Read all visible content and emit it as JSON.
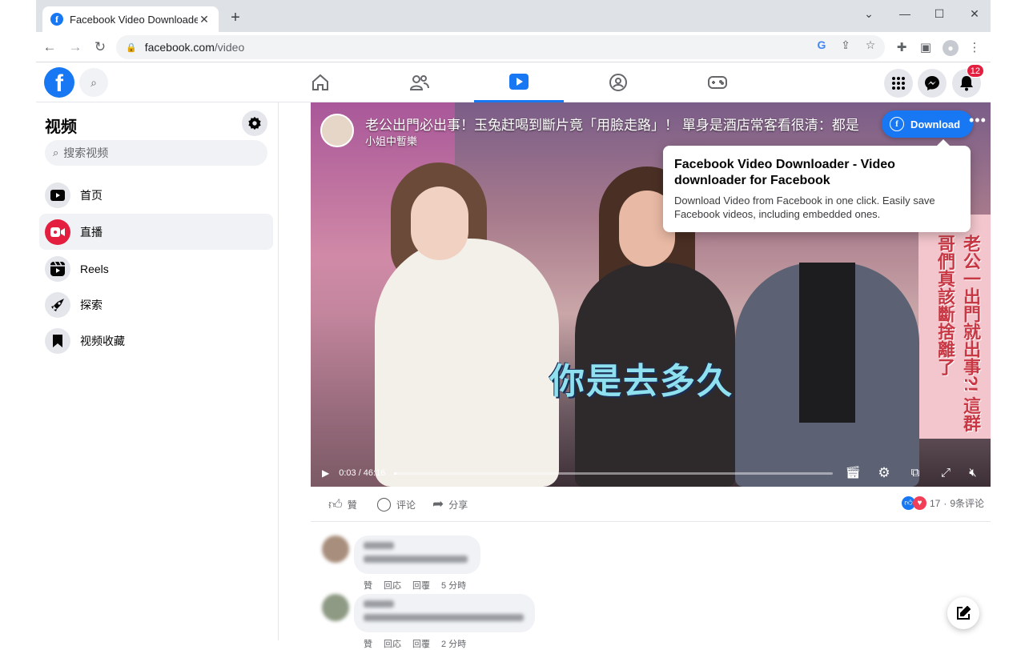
{
  "browser": {
    "tab_title": "Facebook Video Downloader",
    "url_host": "facebook.com",
    "url_path": "/video"
  },
  "fb": {
    "logo": "f",
    "notifications_count": "12"
  },
  "sidebar": {
    "title": "视频",
    "search_placeholder": "搜索视频",
    "items": [
      {
        "label": "首页",
        "icon": "video-home-icon"
      },
      {
        "label": "直播",
        "icon": "live-icon"
      },
      {
        "label": "Reels",
        "icon": "reels-icon"
      },
      {
        "label": "探索",
        "icon": "explore-icon"
      },
      {
        "label": "视频收藏",
        "icon": "saved-icon"
      }
    ]
  },
  "video": {
    "title": "老公出門必出事！玉兔赶喝到斷片竟「用臉走路」！ 單身是酒店常客看很清：都是",
    "channel": "小姐中暫樂",
    "subtitle": "你是去多久",
    "side_caption": "老公一出門就出事?! 這群哥們真該斷捨離了",
    "time": "0:03 / 46:16",
    "progress_percent": 0.1
  },
  "downloader": {
    "button_label": "Download",
    "tooltip_title": "Facebook Video Downloader - Video downloader for Facebook",
    "tooltip_body": "Download Video from Facebook in one click. Easily save Facebook videos, including embedded ones."
  },
  "actions": {
    "like": "贊",
    "comment": "评论",
    "share": "分享",
    "reaction_count": "17",
    "comment_count": "9条评论"
  },
  "comments": [
    {
      "meta_like": "贊",
      "meta_reply": "回応",
      "meta_reply2": "回覆",
      "time": "5 分時"
    },
    {
      "meta_like": "贊",
      "meta_reply": "回応",
      "meta_reply2": "回覆",
      "time": "2 分時"
    }
  ],
  "colors": {
    "brand": "#1877f2",
    "live": "#e41e3f",
    "badge": "#e41e3f"
  }
}
